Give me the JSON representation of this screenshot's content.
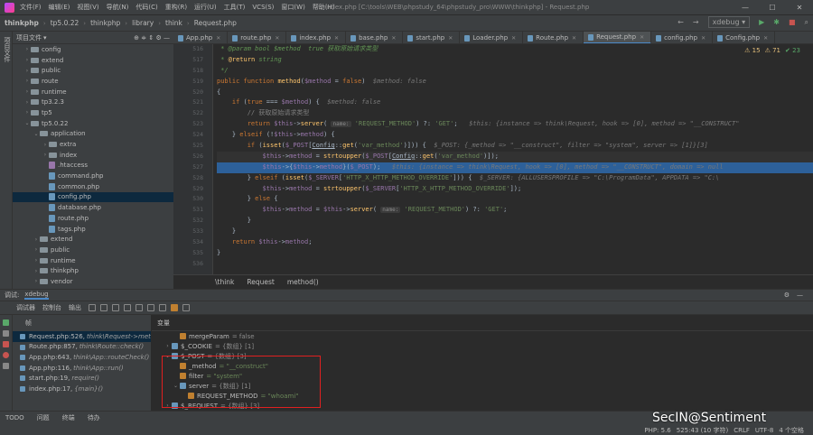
{
  "menu": {
    "items": [
      "文件(F)",
      "编辑(E)",
      "视图(V)",
      "导航(N)",
      "代码(C)",
      "重构(R)",
      "运行(U)",
      "工具(T)",
      "VCS(S)",
      "窗口(W)",
      "帮助(H)"
    ],
    "title": "index.php [C:\\tools\\WEB\\phpstudy_64\\phpstudy_pro\\WWW\\thinkphp] - Request.php"
  },
  "nav": {
    "crumbs": [
      "thinkphp",
      "tp5.0.22",
      "thinkphp",
      "library",
      "think",
      "Request.php"
    ],
    "config": "xdebug"
  },
  "project": {
    "title": "项目文件",
    "tree": [
      {
        "t": "config",
        "d": 1,
        "a": "›",
        "k": "d"
      },
      {
        "t": "extend",
        "d": 1,
        "a": "›",
        "k": "d"
      },
      {
        "t": "public",
        "d": 1,
        "a": "›",
        "k": "d"
      },
      {
        "t": "route",
        "d": 1,
        "a": "›",
        "k": "d"
      },
      {
        "t": "runtime",
        "d": 1,
        "a": "›",
        "k": "d"
      },
      {
        "t": "tp3.2.3",
        "d": 1,
        "a": "›",
        "k": "d"
      },
      {
        "t": "tp5",
        "d": 1,
        "a": "›",
        "k": "d"
      },
      {
        "t": "tp5.0.22",
        "d": 1,
        "a": "⌄",
        "k": "d"
      },
      {
        "t": "application",
        "d": 2,
        "a": "⌄",
        "k": "d"
      },
      {
        "t": "extra",
        "d": 3,
        "a": "›",
        "k": "d"
      },
      {
        "t": "index",
        "d": 3,
        "a": "›",
        "k": "d"
      },
      {
        "t": ".htaccess",
        "d": 3,
        "a": "",
        "k": "h"
      },
      {
        "t": "command.php",
        "d": 3,
        "a": "",
        "k": "f"
      },
      {
        "t": "common.php",
        "d": 3,
        "a": "",
        "k": "f"
      },
      {
        "t": "config.php",
        "d": 3,
        "a": "",
        "k": "f",
        "sel": true
      },
      {
        "t": "database.php",
        "d": 3,
        "a": "",
        "k": "f"
      },
      {
        "t": "route.php",
        "d": 3,
        "a": "",
        "k": "f"
      },
      {
        "t": "tags.php",
        "d": 3,
        "a": "",
        "k": "f"
      },
      {
        "t": "extend",
        "d": 2,
        "a": "›",
        "k": "d"
      },
      {
        "t": "public",
        "d": 2,
        "a": "›",
        "k": "d"
      },
      {
        "t": "runtime",
        "d": 2,
        "a": "›",
        "k": "d"
      },
      {
        "t": "thinkphp",
        "d": 2,
        "a": "›",
        "k": "d"
      },
      {
        "t": "vendor",
        "d": 2,
        "a": "›",
        "k": "d"
      }
    ]
  },
  "tabs": [
    {
      "label": "App.php"
    },
    {
      "label": "route.php"
    },
    {
      "label": "index.php"
    },
    {
      "label": "base.php"
    },
    {
      "label": "start.php"
    },
    {
      "label": "Loader.php"
    },
    {
      "label": "Route.php"
    },
    {
      "label": "Request.php",
      "active": true
    },
    {
      "label": "config.php"
    },
    {
      "label": "Config.php"
    }
  ],
  "inspections": {
    "warn": "⚠ 15",
    "err": "⚠ 71",
    "ok": "✔ 23"
  },
  "lines": [
    "516",
    "517",
    "518",
    "519",
    "520",
    "521",
    "522",
    "523",
    "524",
    "525",
    "526",
    "527",
    "528",
    "529",
    "530",
    "531",
    "532",
    "533",
    "534",
    "535",
    "536"
  ],
  "breadcrumb": [
    "\\think",
    "Request",
    "method()"
  ],
  "debug": {
    "label": "调试:",
    "session": "xdebug",
    "tabs": [
      "调试器",
      "控制台",
      "输出"
    ],
    "frames_title": "帧",
    "vars_title": "变量"
  },
  "frames": [
    {
      "f": "Request.php:526,",
      "m": "think\\Request->method()",
      "sel": true
    },
    {
      "f": "Route.php:857,",
      "m": "think\\Route::check()"
    },
    {
      "f": "App.php:643,",
      "m": "think\\App::routeCheck()"
    },
    {
      "f": "App.php:116,",
      "m": "think\\App::run()"
    },
    {
      "f": "start.php:19,",
      "m": "require()"
    },
    {
      "f": "index.php:17,",
      "m": "{main}()"
    }
  ],
  "vars": [
    {
      "d": 2,
      "a": "",
      "k": "mergeParam",
      "v": "= false"
    },
    {
      "d": 1,
      "a": "›",
      "k": "$_COOKIE",
      "v": "= {数组} [1]"
    },
    {
      "d": 1,
      "a": "⌄",
      "k": "$_POST",
      "v": "= {数组} [3]"
    },
    {
      "d": 2,
      "a": "",
      "k": "_method",
      "v": "= \"__construct\""
    },
    {
      "d": 2,
      "a": "",
      "k": "filter",
      "v": "= \"system\""
    },
    {
      "d": 2,
      "a": "⌄",
      "k": "server",
      "v": "= {数组} [1]"
    },
    {
      "d": 3,
      "a": "",
      "k": "REQUEST_METHOD",
      "v": "= \"whoami\""
    },
    {
      "d": 1,
      "a": "›",
      "k": "$_REQUEST",
      "v": "= {数组} [3]"
    }
  ],
  "status": {
    "tools": [
      "TODO",
      "问题",
      "终端",
      "待办"
    ],
    "php": "PHP: 5.6",
    "pos": "525:43 (10 字符)",
    "crlf": "CRLF",
    "enc": "UTF-8",
    "indent": "4 个空格"
  },
  "watermark": "SecIN@Sentiment",
  "colors": {
    "accent": "#4a88c7",
    "highlight": "#2d6099",
    "annotation": "#e02020"
  }
}
